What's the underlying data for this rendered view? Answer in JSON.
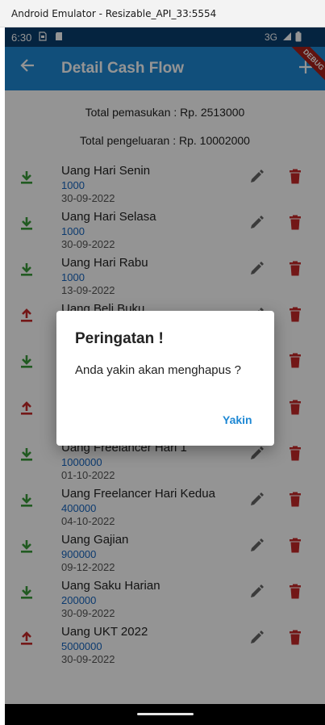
{
  "window": {
    "title": "Android Emulator - Resizable_API_33:5554"
  },
  "status_bar": {
    "time": "6:30",
    "network": "3G"
  },
  "app_bar": {
    "title": "Detail Cash Flow"
  },
  "debug_banner": "DEBUG",
  "summary": {
    "income": "Total pemasukan : Rp. 2513000",
    "expense": "Total pengeluaran : Rp. 10002000"
  },
  "colors": {
    "primary": "#1e88d4",
    "status_bar": "#0a3e6e",
    "income_icon": "#3a9b3a",
    "expense_icon": "#c62828",
    "delete_icon": "#c62828",
    "amount": "#1565c0"
  },
  "transactions": [
    {
      "type": "income",
      "name": "Uang Hari Senin",
      "amount": "1000",
      "date": "30-09-2022"
    },
    {
      "type": "income",
      "name": "Uang Hari Selasa",
      "amount": "1000",
      "date": "30-09-2022"
    },
    {
      "type": "income",
      "name": "Uang Hari Rabu",
      "amount": "1000",
      "date": "13-09-2022"
    },
    {
      "type": "expense",
      "name": "Uang Beli Buku",
      "amount": "",
      "date": ""
    },
    {
      "type": "income",
      "name": "",
      "amount": "",
      "date": ""
    },
    {
      "type": "expense",
      "name": "",
      "amount": "",
      "date": ""
    },
    {
      "type": "income",
      "name": "Uang Freelancer Hari 1",
      "amount": "1000000",
      "date": "01-10-2022"
    },
    {
      "type": "income",
      "name": "Uang Freelancer Hari Kedua",
      "amount": "400000",
      "date": "04-10-2022"
    },
    {
      "type": "income",
      "name": "Uang Gajian",
      "amount": "900000",
      "date": "09-12-2022"
    },
    {
      "type": "income",
      "name": "Uang Saku Harian",
      "amount": "200000",
      "date": "30-09-2022"
    },
    {
      "type": "expense",
      "name": "Uang UKT 2022",
      "amount": "5000000",
      "date": "30-09-2022"
    }
  ],
  "dialog": {
    "title": "Peringatan !",
    "message": "Anda yakin akan menghapus ?",
    "confirm_label": "Yakin"
  }
}
